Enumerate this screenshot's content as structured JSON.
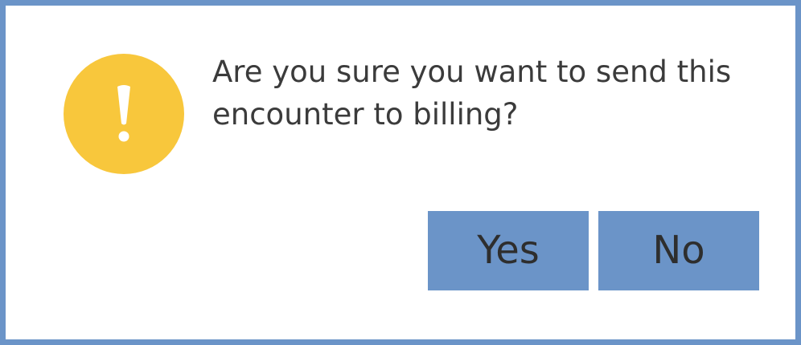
{
  "dialog": {
    "message": "Are you sure you want to send this encounter to billing?",
    "icon": "exclamation-warning-icon",
    "yes_label": "Yes",
    "no_label": "No"
  },
  "colors": {
    "border": "#6b94c8",
    "button_bg": "#6b94c8",
    "warning_icon": "#f8c73c",
    "text": "#3b3b3b"
  }
}
